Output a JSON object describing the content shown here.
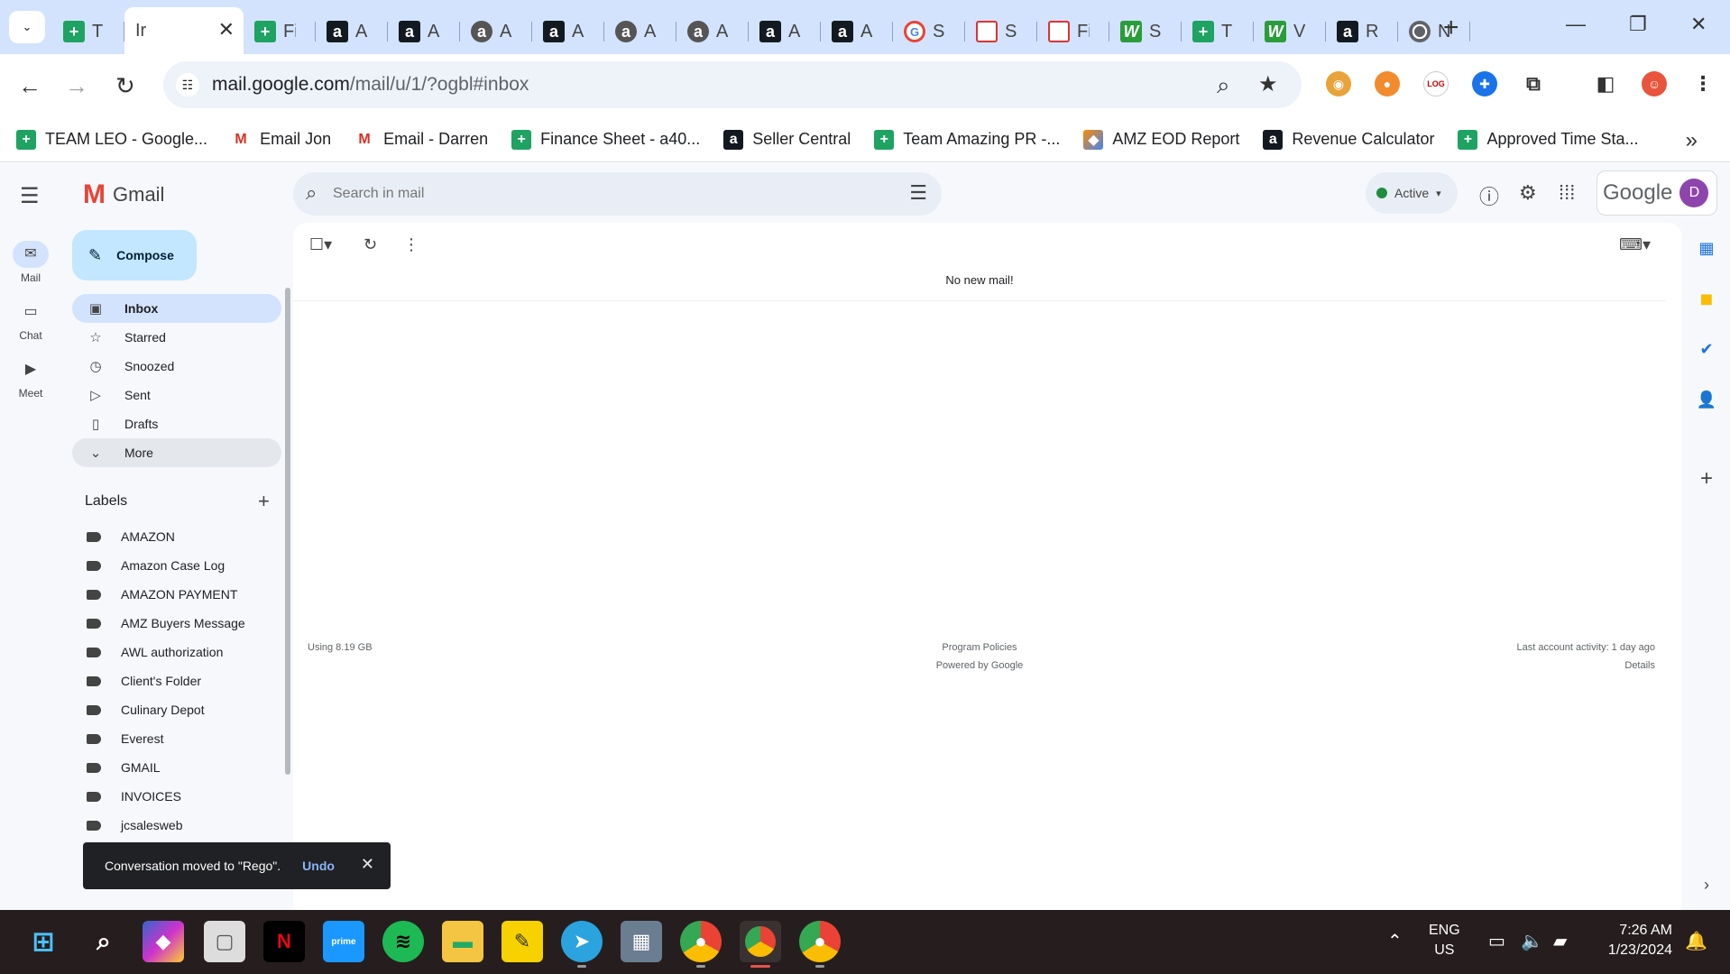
{
  "browser": {
    "tabs": [
      {
        "icon": "sheets",
        "title": "T"
      },
      {
        "icon": "gmail",
        "title": "Ir",
        "active": true
      },
      {
        "icon": "sheets",
        "title": "Fi"
      },
      {
        "icon": "amazon",
        "title": "A"
      },
      {
        "icon": "amazon",
        "title": "A"
      },
      {
        "icon": "amazon-round",
        "title": "A"
      },
      {
        "icon": "amazon",
        "title": "A"
      },
      {
        "icon": "amazon-round",
        "title": "A"
      },
      {
        "icon": "amazon-round",
        "title": "A"
      },
      {
        "icon": "amazon",
        "title": "A"
      },
      {
        "icon": "amazon",
        "title": "A"
      },
      {
        "icon": "google",
        "title": "S"
      },
      {
        "icon": "misc",
        "title": "S"
      },
      {
        "icon": "misc",
        "title": "Fi"
      },
      {
        "icon": "w",
        "title": "S"
      },
      {
        "icon": "sheets",
        "title": "T"
      },
      {
        "icon": "w",
        "title": "V"
      },
      {
        "icon": "amazon",
        "title": "R"
      },
      {
        "icon": "chrome",
        "title": "N"
      }
    ],
    "url_host": "mail.google.com",
    "url_path": "/mail/u/1/?ogbl#inbox",
    "bookmarks": [
      {
        "icon": "sheets",
        "label": "TEAM LEO - Google..."
      },
      {
        "icon": "gmail",
        "label": "Email Jon"
      },
      {
        "icon": "gmail",
        "label": "Email - Darren"
      },
      {
        "icon": "sheets",
        "label": "Finance Sheet - a40..."
      },
      {
        "icon": "amazon",
        "label": "Seller Central"
      },
      {
        "icon": "sheets",
        "label": "Team Amazing PR -..."
      },
      {
        "icon": "eod",
        "label": "AMZ EOD Report"
      },
      {
        "icon": "amazon",
        "label": "Revenue Calculator"
      },
      {
        "icon": "sheets",
        "label": "Approved Time Sta..."
      }
    ]
  },
  "gmail": {
    "brand": "Gmail",
    "search_placeholder": "Search in mail",
    "status": "Active",
    "google_word": "Google",
    "avatar_letter": "D",
    "rail": {
      "mail": "Mail",
      "chat": "Chat",
      "meet": "Meet"
    },
    "compose": "Compose",
    "nav": {
      "inbox": "Inbox",
      "starred": "Starred",
      "snoozed": "Snoozed",
      "sent": "Sent",
      "drafts": "Drafts",
      "more": "More"
    },
    "labels_heading": "Labels",
    "labels": [
      "AMAZON",
      "Amazon Case Log",
      "AMAZON PAYMENT",
      "AMZ Buyers Message",
      "AWL authorization",
      "Client's Folder",
      "Culinary Depot",
      "Everest",
      "GMAIL",
      "INVOICES",
      "jcsalesweb"
    ],
    "empty_message": "No new mail!",
    "footer": {
      "storage": "Using 8.19 GB",
      "policies": "Program Policies",
      "powered": "Powered by Google",
      "activity": "Last account activity: 1 day ago",
      "details": "Details"
    },
    "snackbar": {
      "message": "Conversation moved to \"Rego\".",
      "undo": "Undo"
    }
  },
  "taskbar": {
    "lang_line1": "ENG",
    "lang_line2": "US",
    "time": "7:26 AM",
    "date": "1/23/2024"
  }
}
